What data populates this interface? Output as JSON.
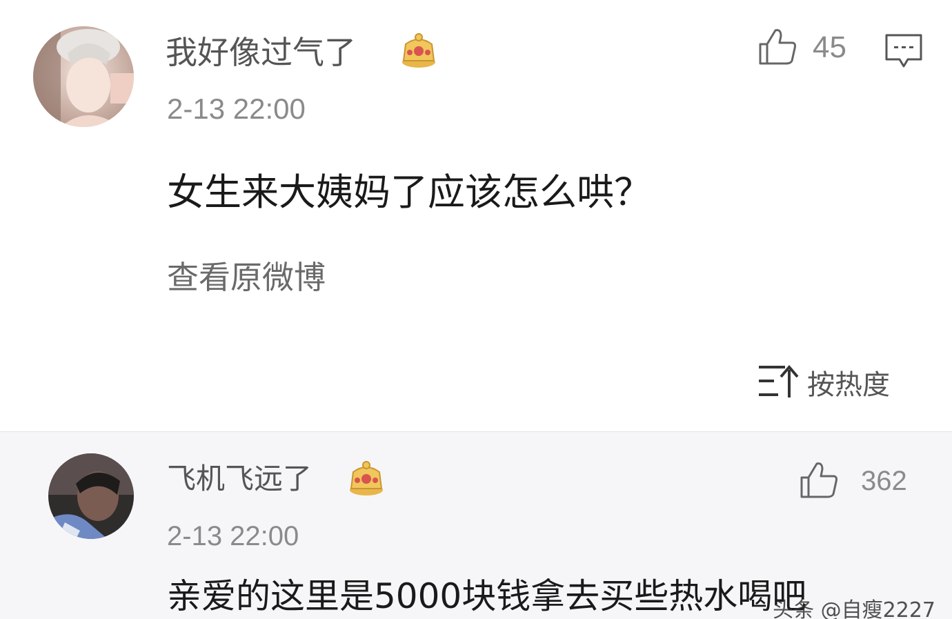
{
  "post": {
    "username": "我好像过气了",
    "timestamp": "2-13 22:00",
    "content": "女生来大姨妈了应该怎么哄？",
    "view_original": "查看原微博",
    "like_count": "45",
    "sort_label": "按热度",
    "icons": {
      "like": "thumbs-up-icon",
      "more": "comment-more-icon",
      "crown": "crown-badge-icon",
      "sort": "sort-icon"
    }
  },
  "comment": {
    "username": "飞机飞远了",
    "timestamp": "2-13 22:00",
    "content": "亲爱的这里是5000块钱拿去买些热水喝吧",
    "like_count": "362"
  },
  "watermark": "头条 @自瘦2227",
  "colors": {
    "background": "#ffffff",
    "comment_background": "#f6f6f8",
    "crown_gold": "#e8b64a",
    "crown_red": "#d9534f",
    "icon_gray": "#666666"
  }
}
